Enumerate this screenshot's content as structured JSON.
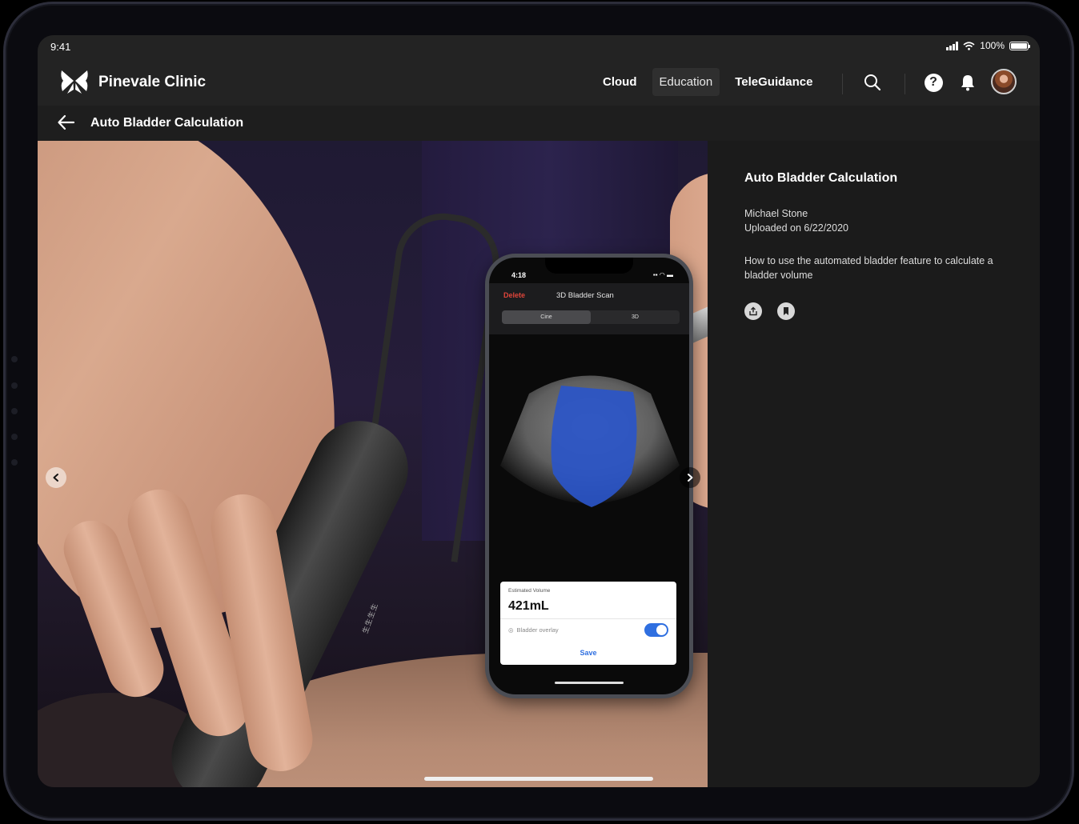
{
  "status_bar": {
    "time": "9:41",
    "battery": "100%"
  },
  "brand": {
    "name": "Pinevale Clinic"
  },
  "nav": {
    "links": [
      {
        "label": "Cloud",
        "active": false
      },
      {
        "label": "Education",
        "active": true
      },
      {
        "label": "TeleGuidance",
        "active": false
      }
    ],
    "help_label": "?"
  },
  "subheader": {
    "title": "Auto Bladder Calculation"
  },
  "phone": {
    "time": "4:18",
    "delete_label": "Delete",
    "title": "3D Bladder Scan",
    "segments": [
      "Cine",
      "3D"
    ],
    "estimated_label": "Estimated Volume",
    "estimated_value": "421mL",
    "overlay_label": "Bladder overlay",
    "save_label": "Save",
    "probe_text": "生生生生"
  },
  "details": {
    "title": "Auto Bladder Calculation",
    "author": "Michael Stone",
    "uploaded": "Uploaded on 6/22/2020",
    "description": "How to use the automated bladder feature to calculate a bladder volume"
  },
  "icons": [
    "butterfly-logo-icon",
    "search-icon",
    "help-icon",
    "bell-icon",
    "back-arrow-icon",
    "chevron-left-icon",
    "chevron-right-icon",
    "share-icon",
    "bookmark-icon"
  ],
  "colors": {
    "background": "#1b1b1b",
    "nav": "#232323",
    "accent_blue": "#2f6fe0",
    "delete_red": "#e0453a",
    "overlay_blue": "#2a55c8"
  }
}
